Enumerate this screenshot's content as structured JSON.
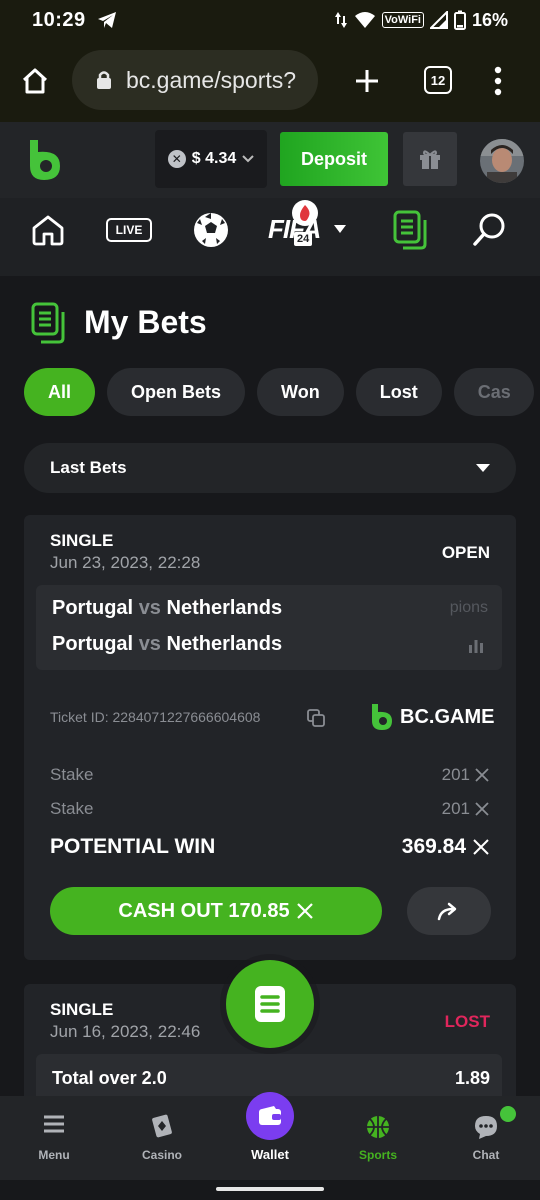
{
  "statusbar": {
    "time": "10:29",
    "vowifi": "VoWiFi",
    "battery": "16%"
  },
  "browser": {
    "url": "bc.game/sports?",
    "tab_count": "12"
  },
  "header": {
    "balance": "$ 4.34",
    "deposit_label": "Deposit"
  },
  "sportnav": {
    "live_label": "LIVE",
    "fifa_label": "FIFA",
    "fifa_num": "24"
  },
  "page": {
    "title": "My Bets"
  },
  "filters": {
    "items": [
      "All",
      "Open Bets",
      "Won",
      "Lost",
      "Cas"
    ],
    "active": "All"
  },
  "dropdown": {
    "selected": "Last Bets"
  },
  "bets": [
    {
      "type": "SINGLE",
      "date": "Jun 23, 2023, 22:28",
      "status": "OPEN",
      "matches": [
        {
          "home": "Portugal",
          "vs": "vs",
          "away": "Netherlands"
        },
        {
          "home": "Portugal",
          "vs": "vs",
          "away": "Netherlands"
        }
      ],
      "faded_text": "pions",
      "ticket_id": "Ticket ID: 2284071227666604608",
      "brand": "BC.GAME",
      "stake_rows": [
        {
          "label": "Stake",
          "value": "201"
        },
        {
          "label": "Stake",
          "value": "201"
        }
      ],
      "potential_label": "POTENTIAL WIN",
      "potential_value": "369.84",
      "cashout_label": "CASH OUT 170.85"
    },
    {
      "type": "SINGLE",
      "date": "Jun 16, 2023, 22:46",
      "status": "LOST",
      "selection": "Total over 2.0",
      "odds": "1.89"
    }
  ],
  "bottomnav": {
    "items": [
      "Menu",
      "Casino",
      "Wallet",
      "Sports",
      "Chat"
    ]
  },
  "colors": {
    "accent": "#45b320",
    "lost": "#e0265c",
    "wallet": "#7b3df0"
  }
}
